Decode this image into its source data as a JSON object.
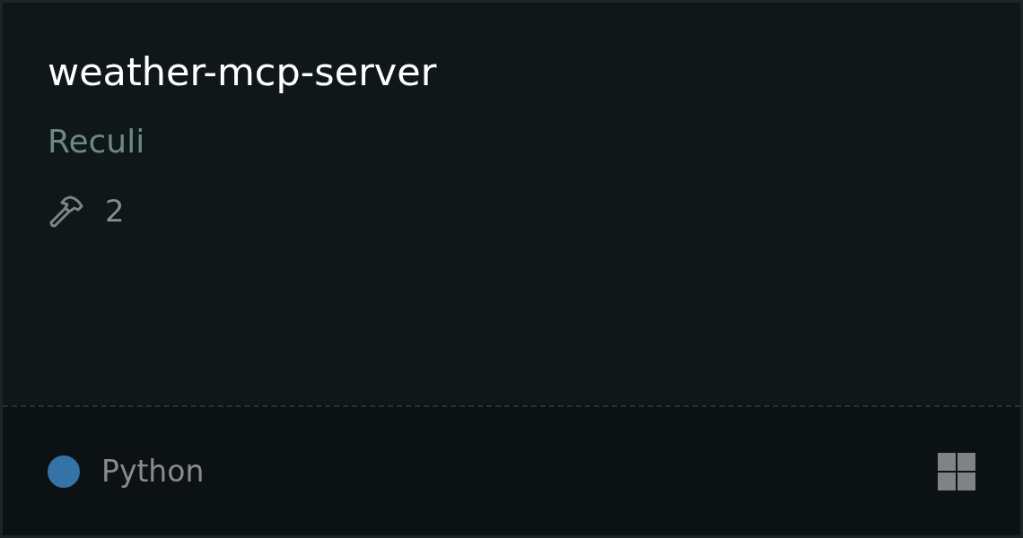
{
  "card": {
    "title": "weather-mcp-server",
    "author": "Reculi",
    "tool_count": "2",
    "language": {
      "name": "Python",
      "color": "#3572a5"
    }
  }
}
